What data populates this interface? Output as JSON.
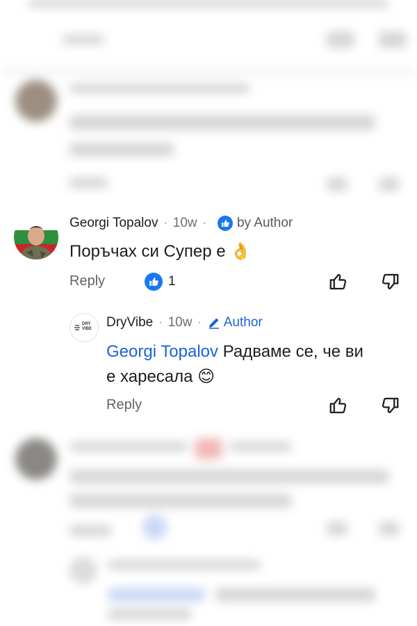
{
  "comments": [
    {
      "name": "Georgi Topalov",
      "time": "10w",
      "badge_label": "by Author",
      "text": "Поръчах си Супер е 👌",
      "reply_label": "Reply",
      "reaction_count": "1",
      "replies": [
        {
          "name": "DryVibe",
          "avatar_logo": "DRY VIBE",
          "time": "10w",
          "badge_label": "Author",
          "mention": "Georgi Topalov",
          "text_line1": " Радваме се, че ви",
          "text_line2": "е харесала 😊",
          "reply_label": "Reply"
        }
      ]
    }
  ],
  "icons": [
    "thumbs-up-icon",
    "thumbs-down-icon",
    "like-badge-icon",
    "pencil-icon"
  ],
  "colors": {
    "accent": "#1a62d6",
    "reaction": "#1877f2",
    "muted": "#5f6368"
  }
}
